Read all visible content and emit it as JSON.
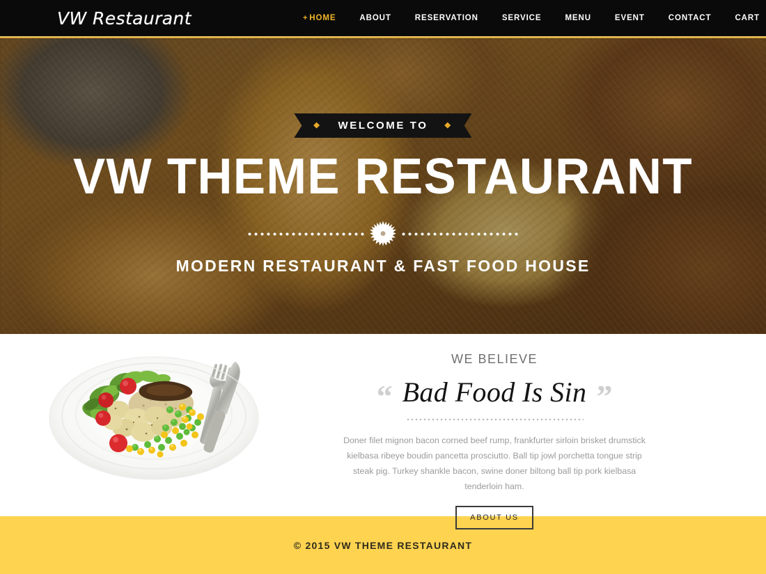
{
  "header": {
    "logo": "VW Restaurant",
    "nav": [
      {
        "label": "HOME",
        "active": true,
        "prefix": "+"
      },
      {
        "label": "ABOUT",
        "active": false
      },
      {
        "label": "RESERVATION",
        "active": false
      },
      {
        "label": "SERVICE",
        "active": false
      },
      {
        "label": "MENU",
        "active": false
      },
      {
        "label": "EVENT",
        "active": false
      },
      {
        "label": "CONTACT",
        "active": false
      },
      {
        "label": "CART",
        "active": false
      }
    ],
    "social": [
      {
        "name": "twitter-icon"
      },
      {
        "name": "pinterest-icon"
      },
      {
        "name": "facebook-icon"
      }
    ],
    "accent_color": "#f0b429",
    "background_color": "#0a0a0a",
    "rule_color": "#d29a20"
  },
  "hero": {
    "ribbon_text": "WELCOME TO",
    "ribbon_diamond": "◆",
    "title": "VW THEME RESTAURANT",
    "subtitle": "MODERN RESTAURANT & FAST FOOD HOUSE",
    "background_image": "fried-fish-and-chips-photo",
    "text_color": "#ffffff"
  },
  "about": {
    "image": "plate-of-food-photo",
    "kicker": "WE BELIEVE",
    "quote_open": "“",
    "quote_close": "”",
    "quote": "Bad Food Is Sin",
    "body": "Doner filet mignon bacon corned beef rump, frankfurter sirloin brisket drumstick kielbasa ribeye boudin pancetta prosciutto. Ball tip jowl porchetta tongue strip steak pig. Turkey shankle bacon, swine doner biltong ball tip pork kielbasa tenderloin ham.",
    "button_label": "ABOUT US"
  },
  "footer": {
    "copyright": "© 2015 VW THEME RESTAURANT",
    "background_color": "#fdd350",
    "text_color": "#2f2a1c"
  }
}
